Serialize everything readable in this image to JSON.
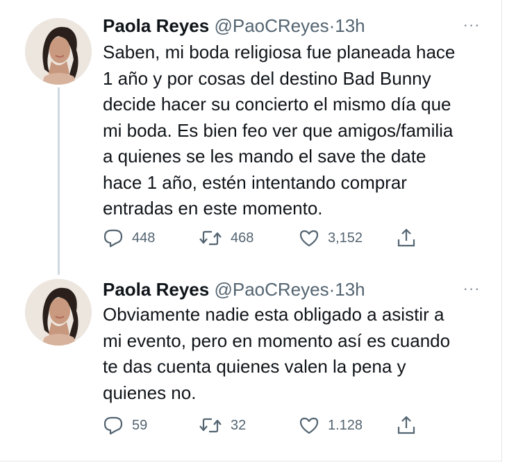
{
  "tweets": [
    {
      "author_name": "Paola Reyes",
      "handle": "@PaoCReyes",
      "separator": "·",
      "time": "13h",
      "more": "···",
      "lines": [
        "Saben, mi boda religiosa fue planeada hace",
        "1 año y por cosas del destino Bad Bunny",
        "decide hacer su concierto el mismo día que",
        "mi boda. Es bien feo ver que amigos/familia",
        "a quienes se les mando el save the date",
        "hace 1 año, estén intentando comprar",
        "entradas en este momento."
      ],
      "replies": "448",
      "retweets": "468",
      "likes": "3,152"
    },
    {
      "author_name": "Paola Reyes",
      "handle": "@PaoCReyes",
      "separator": "·",
      "time": "13h",
      "more": "···",
      "lines": [
        "Obviamente nadie esta obligado a asistir a",
        "mi evento, pero en momento así es cuando",
        "te das cuenta quienes valen la pena y",
        "quienes no."
      ],
      "replies": "59",
      "retweets": "32",
      "likes": "1.128"
    }
  ],
  "icons": {
    "reply": "reply-icon",
    "retweet": "retweet-icon",
    "like": "heart-icon",
    "share": "share-icon",
    "more": "more-icon"
  },
  "colors": {
    "text": "#0f1419",
    "secondary": "#536471",
    "thread_line": "#cfd9de",
    "background": "#ffffff"
  }
}
